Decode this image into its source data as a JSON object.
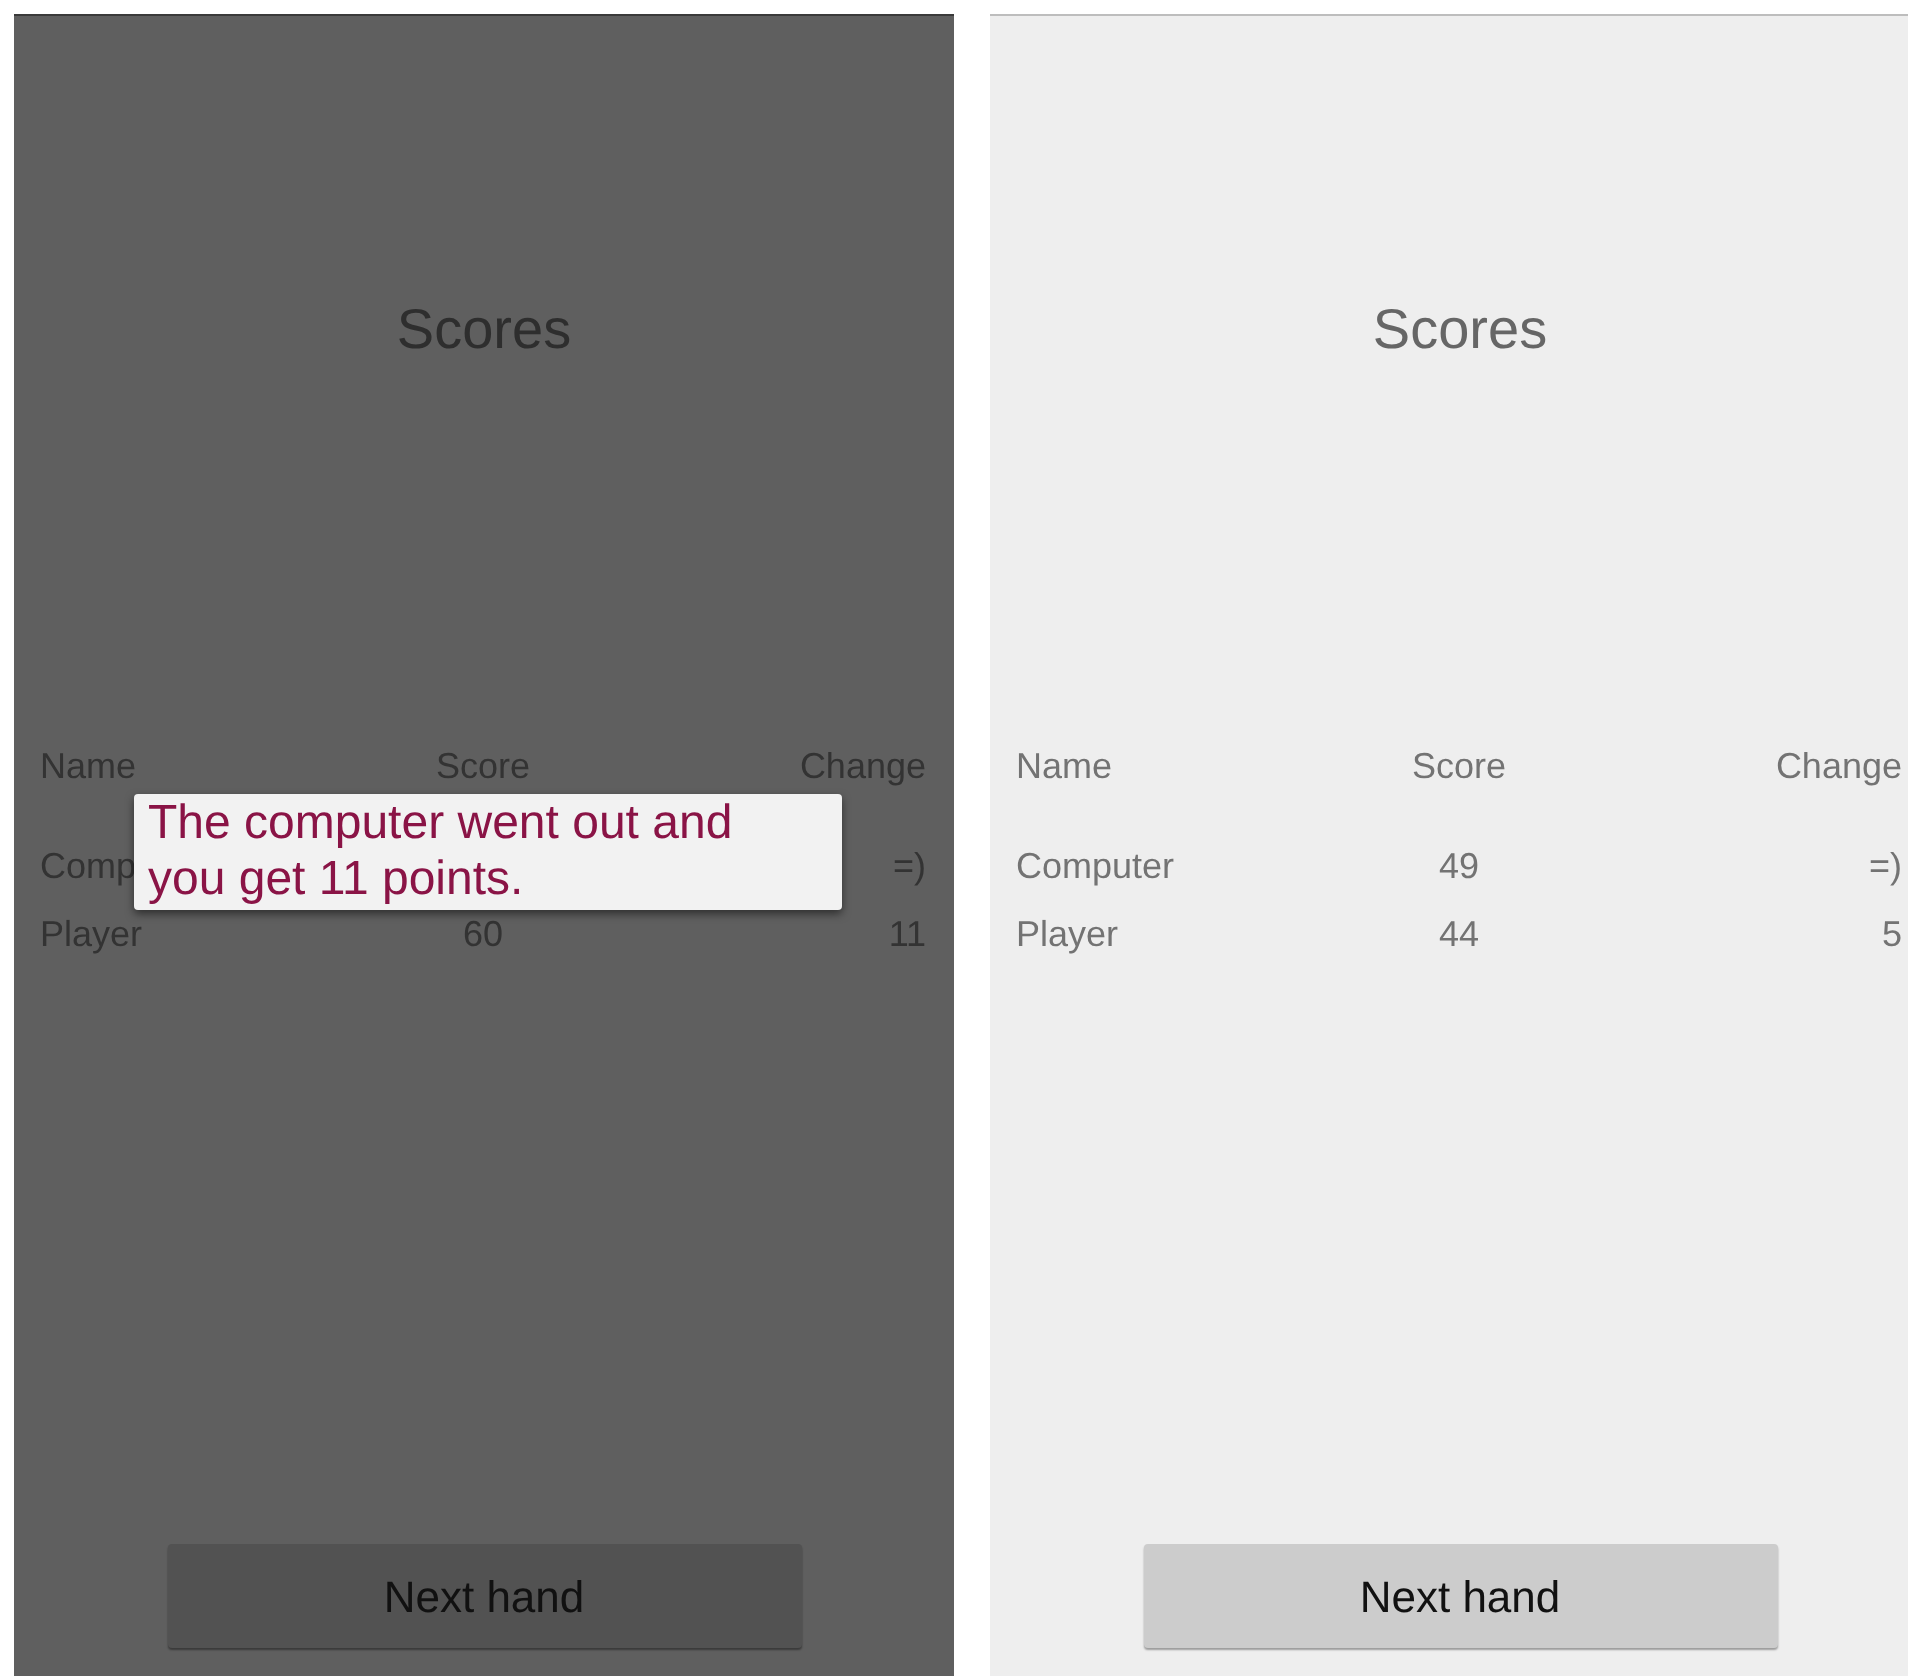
{
  "screens": [
    {
      "dimmed": true,
      "title": "Scores",
      "columns": [
        "Name",
        "Score",
        "Change"
      ],
      "rows": [
        {
          "name": "Comp",
          "change": "=)"
        },
        {
          "name": "Player",
          "score": "60",
          "change": "11"
        }
      ],
      "toast": "The computer went out and you get 11 points.",
      "button": "Next hand"
    },
    {
      "dimmed": false,
      "title": "Scores",
      "columns": [
        "Name",
        "Score",
        "Change"
      ],
      "rows": [
        {
          "name": "Computer",
          "score": "49",
          "change": "=)"
        },
        {
          "name": "Player",
          "score": "44",
          "change": "5"
        }
      ],
      "button": "Next hand"
    }
  ]
}
